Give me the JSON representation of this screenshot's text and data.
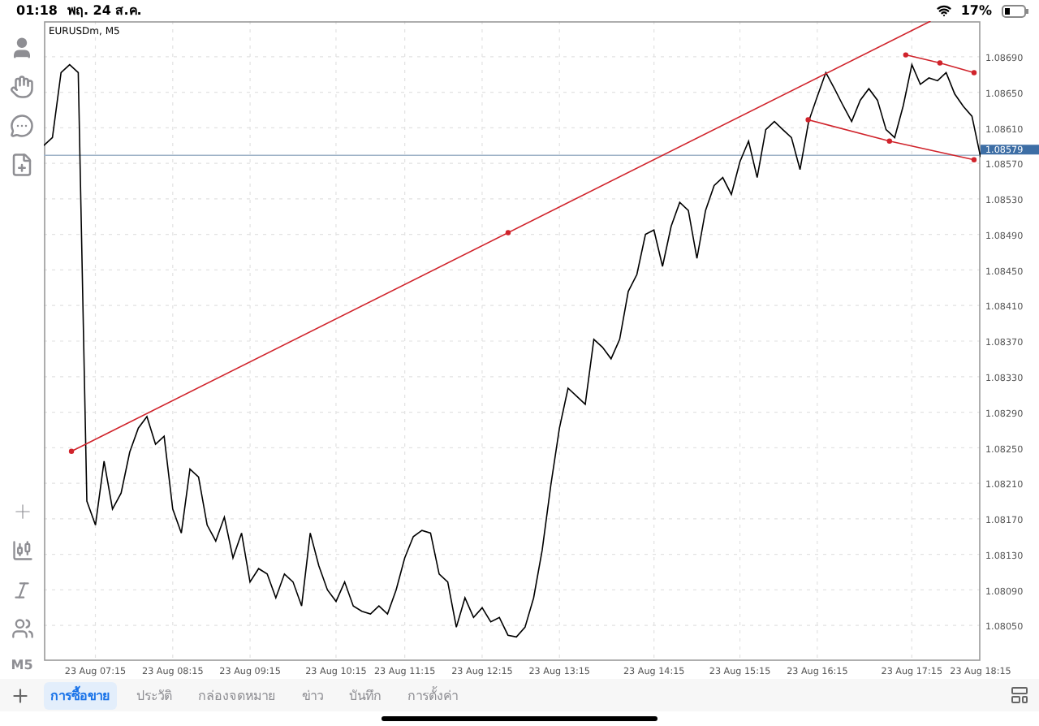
{
  "status_bar": {
    "time": "01:18",
    "date": "พฤ. 24 ส.ค.",
    "battery": "17%"
  },
  "toolbar": {
    "timeframe": "M5"
  },
  "chart": {
    "title": "EURUSDm, M5",
    "drawings": [
      {
        "kind": "ray"
      },
      {
        "kind": "polyline"
      },
      {
        "kind": "polyline"
      }
    ],
    "chart_data": {
      "type": "line",
      "grid": true,
      "ylim": [
        1.0801,
        1.0873
      ],
      "ref_lines": [
        {
          "axis": "y",
          "value": 1.08579,
          "label": "1.08579"
        }
      ],
      "yticks": [
        {
          "value": 1.0869,
          "label": "1.08690"
        },
        {
          "value": 1.0865,
          "label": "1.08650"
        },
        {
          "value": 1.0861,
          "label": "1.08610"
        },
        {
          "value": 1.0857,
          "label": "1.08570"
        },
        {
          "value": 1.0853,
          "label": "1.08530"
        },
        {
          "value": 1.0849,
          "label": "1.08490"
        },
        {
          "value": 1.0845,
          "label": "1.08450"
        },
        {
          "value": 1.0841,
          "label": "1.08410"
        },
        {
          "value": 1.0837,
          "label": "1.08370"
        },
        {
          "value": 1.0833,
          "label": "1.08330"
        },
        {
          "value": 1.0829,
          "label": "1.08290"
        },
        {
          "value": 1.0825,
          "label": "1.08250"
        },
        {
          "value": 1.0821,
          "label": "1.08210"
        },
        {
          "value": 1.0817,
          "label": "1.08170"
        },
        {
          "value": 1.0813,
          "label": "1.08130"
        },
        {
          "value": 1.0809,
          "label": "1.08090"
        },
        {
          "value": 1.0805,
          "label": "1.08050"
        }
      ],
      "categories": [
        null,
        null,
        null,
        null,
        null,
        null,
        "23 Aug 07:15",
        null,
        null,
        null,
        null,
        null,
        null,
        null,
        null,
        "23 Aug 08:15",
        null,
        null,
        null,
        null,
        null,
        null,
        null,
        null,
        "23 Aug 09:15",
        null,
        null,
        null,
        null,
        null,
        null,
        null,
        null,
        null,
        "23 Aug 10:15",
        null,
        null,
        null,
        null,
        null,
        null,
        null,
        "23 Aug 11:15",
        null,
        null,
        null,
        null,
        null,
        null,
        null,
        null,
        "23 Aug 12:15",
        null,
        null,
        null,
        null,
        null,
        null,
        null,
        null,
        "23 Aug 13:15",
        null,
        null,
        null,
        null,
        null,
        null,
        null,
        null,
        null,
        null,
        "23 Aug 14:15",
        null,
        null,
        null,
        null,
        null,
        null,
        null,
        null,
        null,
        "23 Aug 15:15",
        null,
        null,
        null,
        null,
        null,
        null,
        null,
        null,
        "23 Aug 16:15",
        null,
        null,
        null,
        null,
        null,
        null,
        null,
        null,
        null,
        null,
        "23 Aug 17:15",
        null,
        null,
        null,
        null,
        null,
        null,
        null,
        "23 Aug 18:15"
      ],
      "series": [
        {
          "color": "#000000",
          "values": [
            1.0859,
            1.08599,
            1.08672,
            1.08681,
            1.08672,
            1.0819,
            1.08163,
            1.08235,
            1.08181,
            1.08199,
            1.08245,
            1.08272,
            1.08285,
            1.08254,
            1.08263,
            1.08181,
            1.08154,
            1.08226,
            1.08217,
            1.08163,
            1.08145,
            1.08172,
            1.08126,
            1.08154,
            1.08099,
            1.08114,
            1.08108,
            1.08081,
            1.08108,
            1.08099,
            1.08072,
            1.08154,
            1.08117,
            1.0809,
            1.08077,
            1.08099,
            1.08072,
            1.08066,
            1.08063,
            1.08072,
            1.08063,
            1.0809,
            1.08126,
            1.0815,
            1.08157,
            1.08154,
            1.08108,
            1.08099,
            1.08048,
            1.08081,
            1.08059,
            1.0807,
            1.08054,
            1.08059,
            1.08039,
            1.08037,
            1.08048,
            1.08081,
            1.08135,
            1.08208,
            1.08272,
            1.08317,
            1.08308,
            1.08299,
            1.08372,
            1.08363,
            1.0835,
            1.08372,
            1.08426,
            1.08445,
            1.0849,
            1.08495,
            1.08454,
            1.08499,
            1.08526,
            1.08517,
            1.08463,
            1.08517,
            1.08545,
            1.08554,
            1.08535,
            1.08572,
            1.08595,
            1.08554,
            1.08608,
            1.08617,
            1.08608,
            1.08599,
            1.08563,
            1.08617,
            1.08645,
            1.08672,
            1.08654,
            1.08635,
            1.08617,
            1.08641,
            1.08654,
            1.08641,
            1.08608,
            1.08599,
            1.08635,
            1.08681,
            1.08659,
            1.08666,
            1.08663,
            1.08672,
            1.08648,
            1.08634,
            1.08623,
            1.08577
          ]
        }
      ]
    }
  },
  "tabs": [
    {
      "label": "การซื้อขาย",
      "selected": true
    },
    {
      "label": "ประวัติ",
      "selected": false
    },
    {
      "label": "กล่องจดหมาย",
      "selected": false
    },
    {
      "label": "ข่าว",
      "selected": false
    },
    {
      "label": "บันทึก",
      "selected": false
    },
    {
      "label": "การตั้งค่า",
      "selected": false
    }
  ]
}
